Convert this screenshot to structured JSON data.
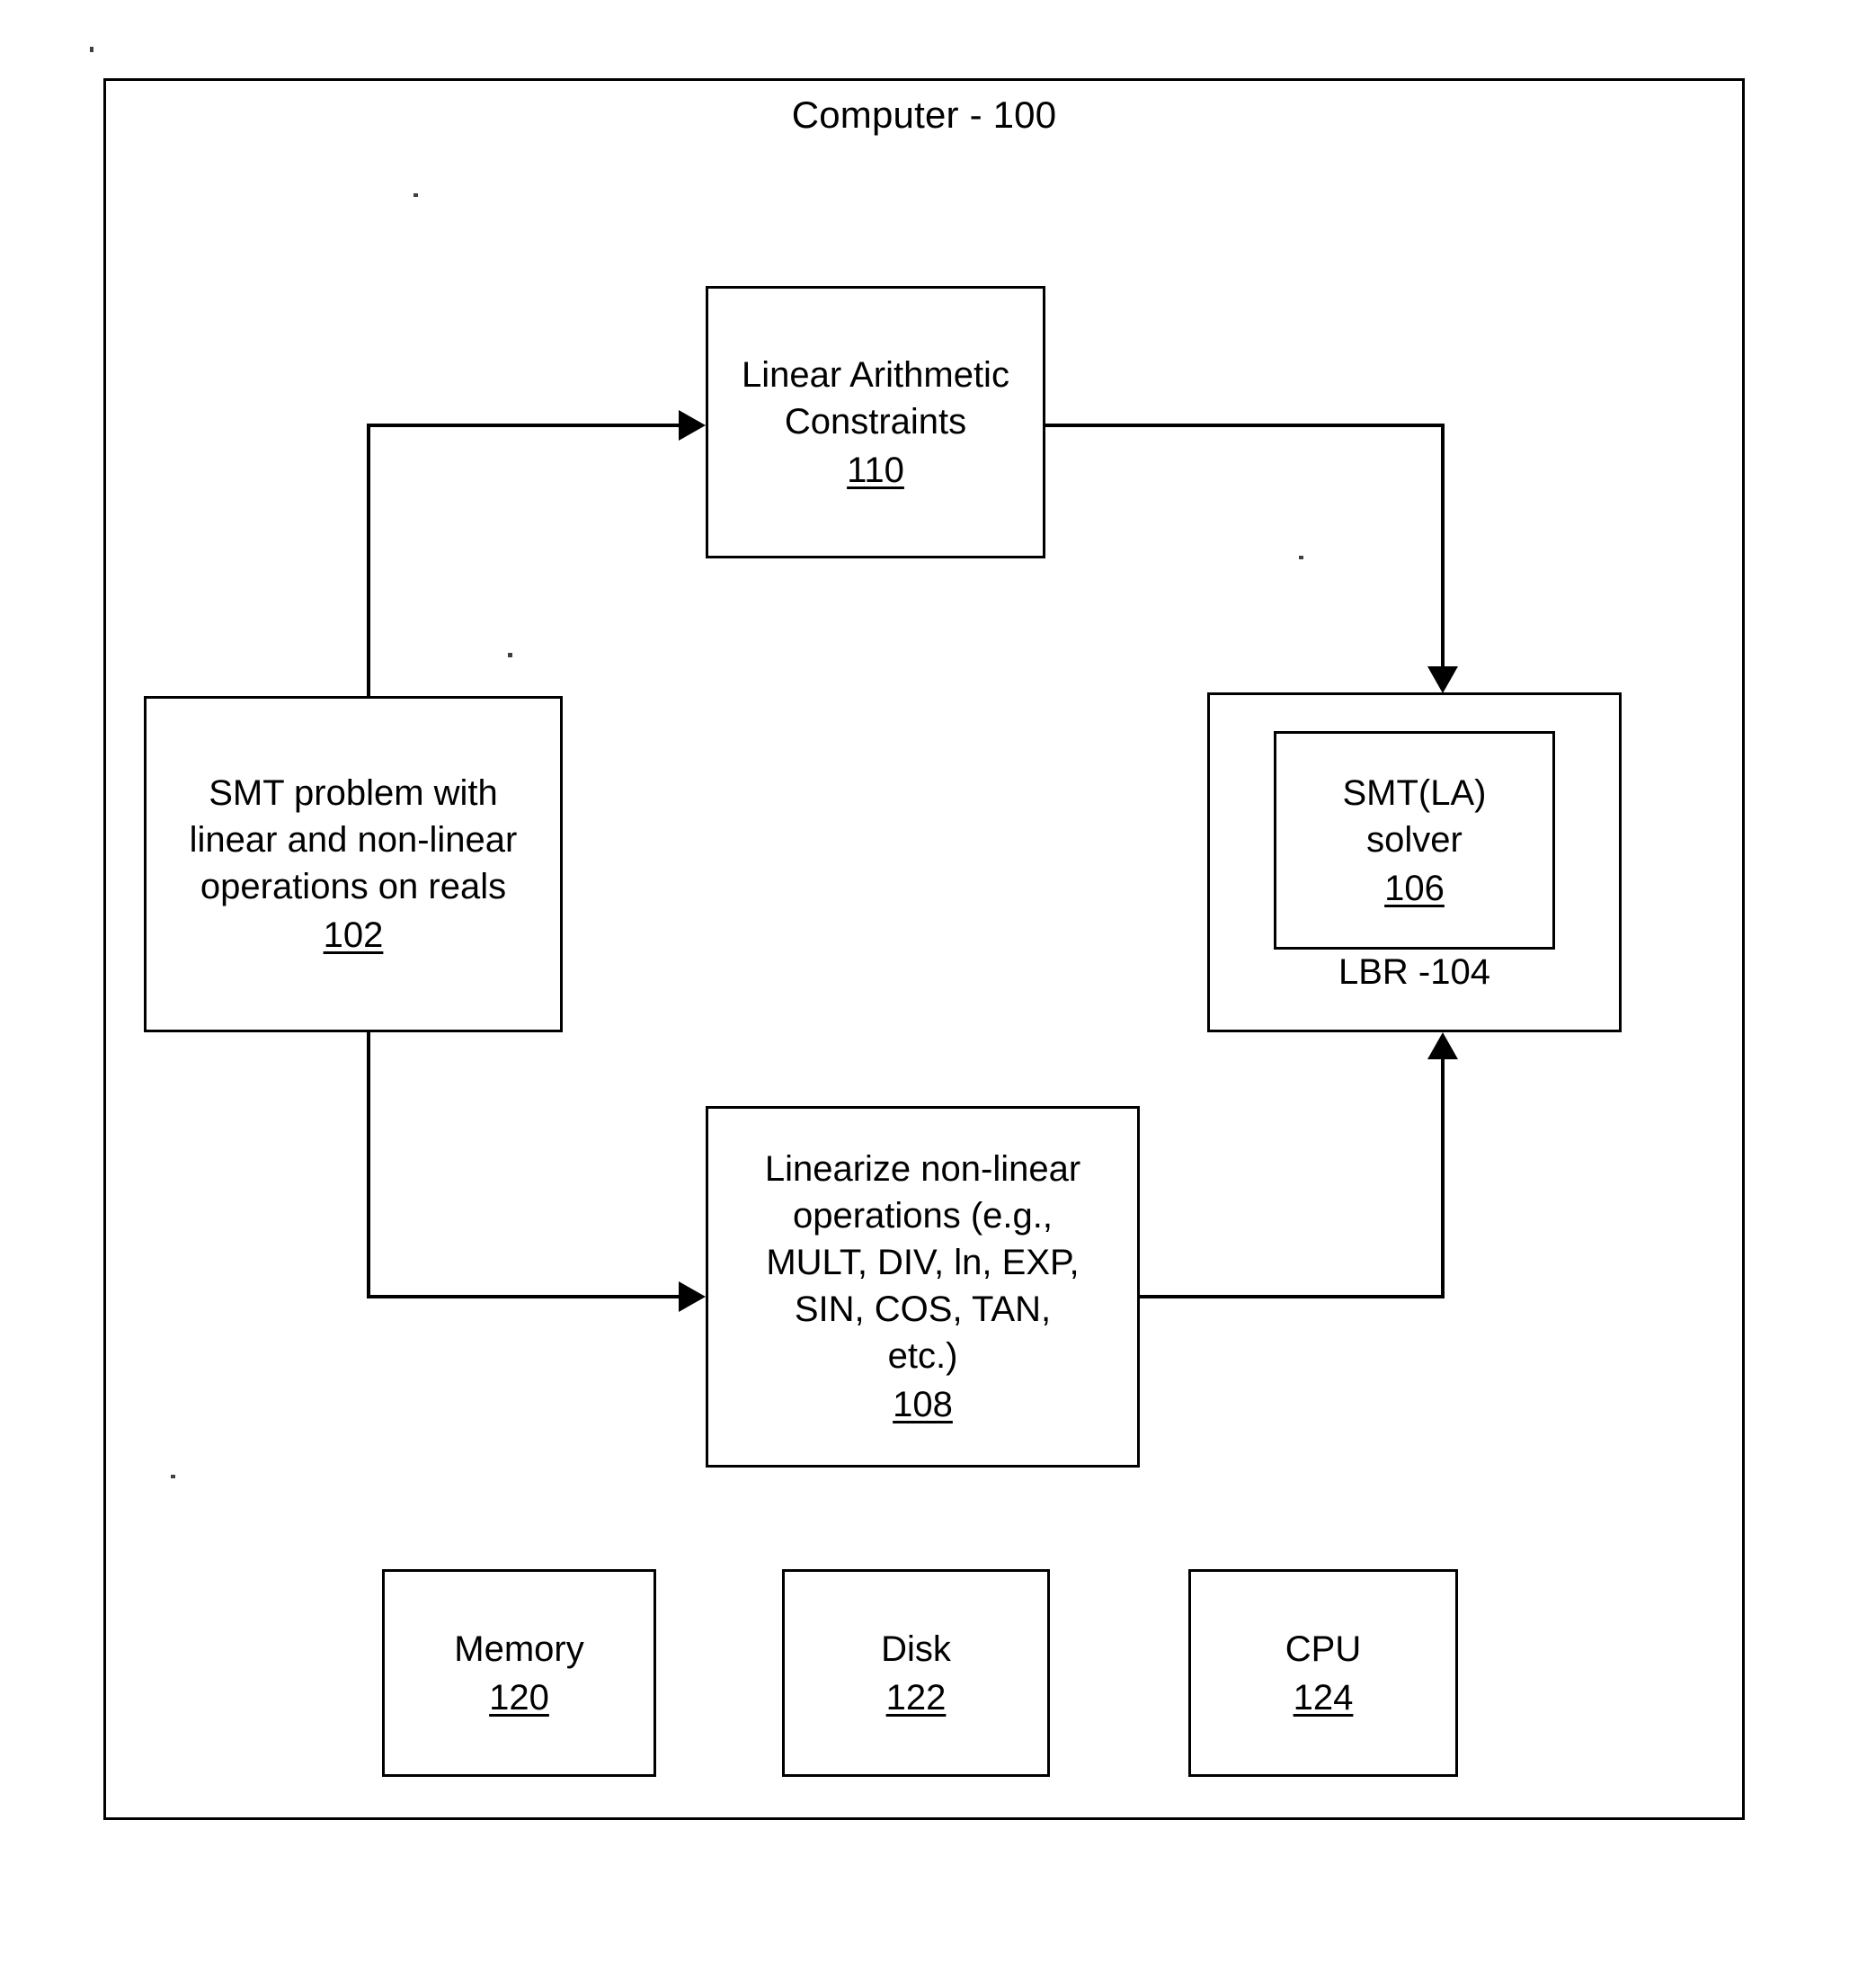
{
  "figure": {
    "frame_title": "Computer - 100",
    "frame_ref": "100"
  },
  "nodes": {
    "linear_arithmetic_constraints": {
      "label": "Linear Arithmetic\nConstraints",
      "ref": "110"
    },
    "smt_problem": {
      "label": "SMT problem with\nlinear and non-linear\noperations on reals",
      "ref": "102"
    },
    "lbr": {
      "caption": "LBR -104",
      "ref": "104"
    },
    "smt_la_solver": {
      "label": "SMT(LA)\nsolver",
      "ref": "106"
    },
    "linearize": {
      "label": "Linearize non-linear\noperations (e.g.,\nMULT, DIV, ln, EXP,\nSIN, COS, TAN,\netc.)",
      "ref": "108"
    },
    "memory": {
      "label": "Memory",
      "ref": "120"
    },
    "disk": {
      "label": "Disk",
      "ref": "122"
    },
    "cpu": {
      "label": "CPU",
      "ref": "124"
    }
  },
  "edges": [
    {
      "name": "smt-problem-to-linear-arithmetic-constraints",
      "from": "smt_problem",
      "to": "linear_arithmetic_constraints",
      "arrowhead": "right"
    },
    {
      "name": "linear-arithmetic-constraints-to-lbr",
      "from": "linear_arithmetic_constraints",
      "to": "lbr",
      "arrowhead": "down"
    },
    {
      "name": "smt-problem-to-linearize",
      "from": "smt_problem",
      "to": "linearize",
      "arrowhead": "right"
    },
    {
      "name": "linearize-to-lbr",
      "from": "linearize",
      "to": "lbr",
      "arrowhead": "up"
    }
  ],
  "colors": {
    "ink": "#000000",
    "paper": "#ffffff"
  }
}
